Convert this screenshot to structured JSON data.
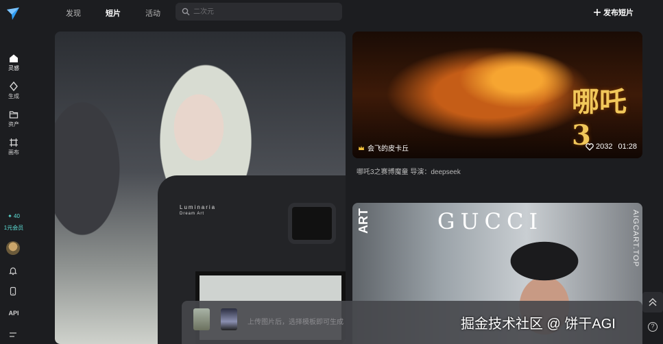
{
  "topbar": {
    "tabs": [
      {
        "label": "发现",
        "active": false
      },
      {
        "label": "短片",
        "active": true
      },
      {
        "label": "活动",
        "active": false
      }
    ],
    "search_placeholder": "二次元",
    "publish_label": "发布短片"
  },
  "sidebar": {
    "items": [
      {
        "label": "灵感",
        "icon": "home-icon",
        "active": true
      },
      {
        "label": "生成",
        "icon": "sparkle-icon",
        "active": false
      },
      {
        "label": "资产",
        "icon": "folder-icon",
        "active": false
      },
      {
        "label": "画布",
        "icon": "canvas-icon",
        "active": false
      }
    ],
    "credits": "✦ 40",
    "vip_label": "1元会员",
    "api_label": "API"
  },
  "cards": {
    "left": {
      "watermark_main": "Luminaria",
      "watermark_sub": "Dream Art"
    },
    "right_top": {
      "title_art": "哪吒3",
      "author": "会飞的皮卡丘",
      "likes": "2032",
      "duration": "01:28",
      "caption": "哪吒3之赛博魔童 导演：deepseek"
    },
    "right_bottom": {
      "brand": "GUCCI",
      "logo": "ART",
      "side_text": "AIGCART.TOP"
    }
  },
  "upload_bar": {
    "hint": "上传图片后，选择模板即可生成"
  },
  "watermark": "掘金技术社区 @ 饼干AGI",
  "help_label": "?",
  "colors": {
    "accent": "#5ee0d8",
    "background": "#1c1d20"
  }
}
